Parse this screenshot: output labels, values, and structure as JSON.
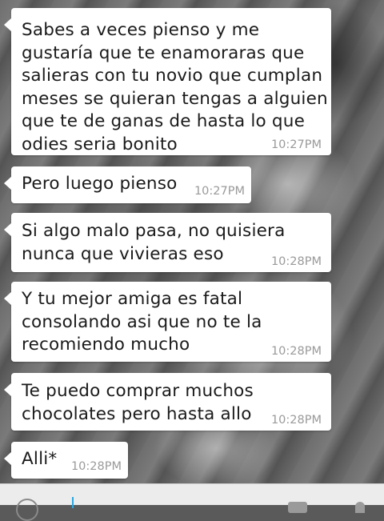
{
  "messages": [
    {
      "text": "Sabes a veces pienso y me\ngustaría que te enamoraras que\nsalieras con tu novio que cumplan\nmeses se quieran tengas a alguien\nque te de ganas de hasta lo que\nodies seria bonito",
      "time": "10:27PM"
    },
    {
      "text": "Pero luego pienso",
      "time": "10:27PM"
    },
    {
      "text": "Si algo malo pasa, no quisiera\nnunca que vivieras eso",
      "time": "10:28PM"
    },
    {
      "text": "Y tu mejor amiga es fatal\nconsolando asi que no te la\nrecomiendo mucho",
      "time": "10:28PM"
    },
    {
      "text": "Te puedo comprar muchos\nchocolates pero hasta allo",
      "time": "10:28PM"
    },
    {
      "text": "Alli*",
      "time": "10:28PM"
    }
  ],
  "input_bar": {
    "emoji_icon": "smiley-icon",
    "attach_icon": "camera-icon",
    "send_icon": "microphone-icon"
  },
  "colors": {
    "bubble": "#ffffff",
    "timestamp": "#9a9a9a",
    "cursor": "#2aa8e0"
  }
}
